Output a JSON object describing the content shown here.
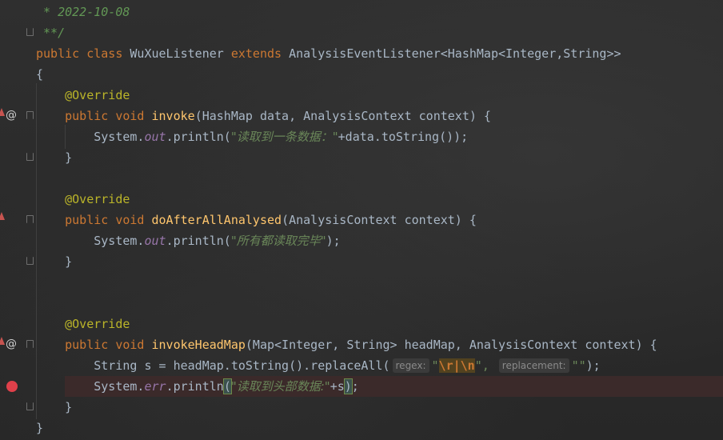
{
  "editor": {
    "lines": {
      "c1": " * 2022-10-08",
      "c2": " **/",
      "class_kw1": "public",
      "class_kw2": "class",
      "class_name": "WuXueListener",
      "class_kw3": "extends",
      "class_super": "AnalysisEventListener<HashMap<Integer,String>>",
      "open_brace": "{",
      "override": "@Override",
      "public": "public",
      "void": "void",
      "m1_name": "invoke",
      "m1_params": "(HashMap data, AnalysisContext context) {",
      "sys": "System.",
      "out": "out",
      "err": "err",
      "println": ".println(",
      "m1_str": "\"读取到一条数据：\"",
      "m1_tail": "+data.toString());",
      "close_brace": "}",
      "m2_name": "doAfterAllAnalysed",
      "m2_params": "(AnalysisContext context) {",
      "m2_str": "\"所有都读取完毕\"",
      "m2_tail": ");",
      "m3_name": "invokeHeadMap",
      "m3_params": "(Map<Integer, String> headMap, AnalysisContext context) {",
      "s_decl": "String s = headMap.toString().replaceAll(",
      "hint_regex": "regex:",
      "q_open": "\"",
      "esc_seq": "\\r|\\n",
      "q_close": "\",",
      "hint_replacement": "replacement:",
      "empty_str": "\"\"",
      "s_tail": ");",
      "m3_str": "\"读取到头部数据:\"",
      "m3_tail_plus": "+s",
      "m3_tail_end": ";",
      "paren_open": "(",
      "paren_close": ")"
    }
  },
  "colors": {
    "keyword": "#cc7832",
    "annotation": "#bbb529",
    "method": "#ffc66d",
    "string": "#6a8759",
    "field": "#9876aa",
    "breakpoint": "#e0404a"
  },
  "icons": {
    "override_marker": "override-up-arrow-icon",
    "implements_marker": "at-sign-icon",
    "fold": "fold-marker-icon",
    "breakpoint": "breakpoint-dot-icon"
  }
}
